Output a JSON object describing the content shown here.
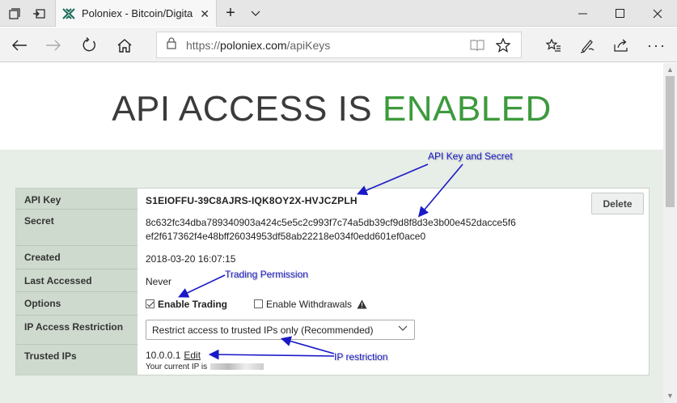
{
  "browser": {
    "tab_title": "Poloniex - Bitcoin/Digita",
    "url_scheme": "https://",
    "url_host": "poloniex.com",
    "url_path": "/apiKeys"
  },
  "page": {
    "title_part1": "API ACCESS IS ",
    "title_part2": "ENABLED",
    "rows": {
      "api_key_label": "API Key",
      "api_key_value": "S1EIOFFU-39C8AJRS-IQK8OY2X-HVJCZPLH",
      "secret_label": "Secret",
      "secret_line1": "8c632fc34dba789340903a424c5e5c2c993f7c74a5db39cf9d8f8d3e3b00e452dacce5f6",
      "secret_line2": "ef2f617362f4e48bff26034953df58ab22218e034f0edd601ef0ace0",
      "created_label": "Created",
      "created_value": "2018-03-20 16:07:15",
      "last_accessed_label": "Last Accessed",
      "last_accessed_value": "Never",
      "options_label": "Options",
      "enable_trading": "Enable Trading",
      "enable_withdrawals": "Enable Withdrawals",
      "ip_restriction_label": "IP Access Restriction",
      "ip_restriction_value": "Restrict access to trusted IPs only (Recommended)",
      "trusted_ips_label": "Trusted IPs",
      "trusted_ip": "10.0.0.1",
      "edit_link": "Edit",
      "current_ip_text": "Your current IP is"
    },
    "delete_button": "Delete"
  },
  "annotations": {
    "api_key_secret": "API Key and Secret",
    "trading_permission": "Trading Permission",
    "ip_restriction": "IP restriction"
  },
  "colors": {
    "enabled_green": "#3d9a3d",
    "annotation_blue": "#1919c8",
    "label_column": "#cfdacf",
    "background": "#e7ede7"
  }
}
